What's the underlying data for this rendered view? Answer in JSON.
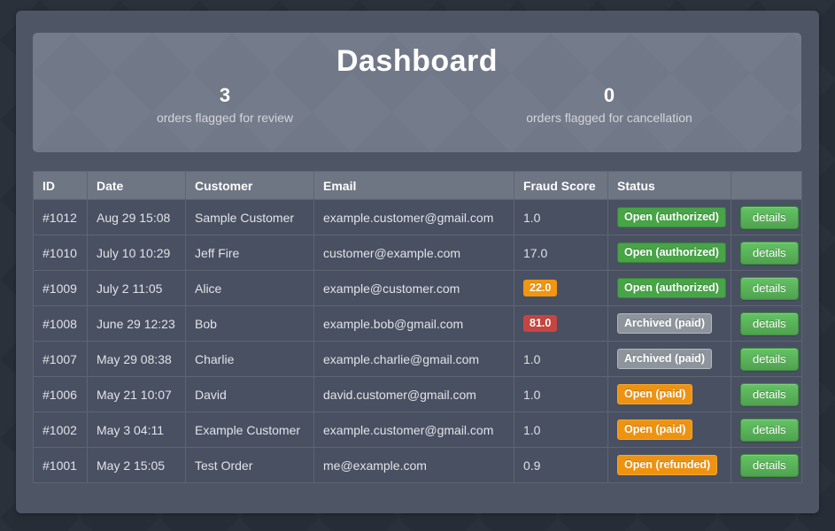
{
  "header": {
    "title": "Dashboard",
    "stats": [
      {
        "count": "3",
        "label": "orders flagged for review"
      },
      {
        "count": "0",
        "label": "orders flagged for cancellation"
      }
    ]
  },
  "table": {
    "columns": [
      "ID",
      "Date",
      "Customer",
      "Email",
      "Fraud Score",
      "Status",
      ""
    ],
    "details_label": "details",
    "rows": [
      {
        "id": "#1012",
        "date": "Aug 29 15:08",
        "customer": "Sample Customer",
        "email": "example.customer@gmail.com",
        "fraud_score": "1.0",
        "fraud_level": "plain",
        "status": "Open (authorized)",
        "status_type": "green"
      },
      {
        "id": "#1010",
        "date": "July 10 10:29",
        "customer": "Jeff Fire",
        "email": "customer@example.com",
        "fraud_score": "17.0",
        "fraud_level": "plain",
        "status": "Open (authorized)",
        "status_type": "green"
      },
      {
        "id": "#1009",
        "date": "July 2 11:05",
        "customer": "Alice",
        "email": "example@customer.com",
        "fraud_score": "22.0",
        "fraud_level": "orange",
        "status": "Open (authorized)",
        "status_type": "green"
      },
      {
        "id": "#1008",
        "date": "June 29 12:23",
        "customer": "Bob",
        "email": "example.bob@gmail.com",
        "fraud_score": "81.0",
        "fraud_level": "red",
        "status": "Archived (paid)",
        "status_type": "gray"
      },
      {
        "id": "#1007",
        "date": "May 29 08:38",
        "customer": "Charlie",
        "email": "example.charlie@gmail.com",
        "fraud_score": "1.0",
        "fraud_level": "plain",
        "status": "Archived (paid)",
        "status_type": "gray"
      },
      {
        "id": "#1006",
        "date": "May 21 10:07",
        "customer": "David",
        "email": "david.customer@gmail.com",
        "fraud_score": "1.0",
        "fraud_level": "plain",
        "status": "Open (paid)",
        "status_type": "orange"
      },
      {
        "id": "#1002",
        "date": "May 3 04:11",
        "customer": "Example Customer",
        "email": "example.customer@gmail.com",
        "fraud_score": "1.0",
        "fraud_level": "plain",
        "status": "Open (paid)",
        "status_type": "orange"
      },
      {
        "id": "#1001",
        "date": "May 2 15:05",
        "customer": "Test Order",
        "email": "me@example.com",
        "fraud_score": "0.9",
        "fraud_level": "plain",
        "status": "Open (refunded)",
        "status_type": "orange"
      }
    ]
  },
  "colors": {
    "page_background": "#272d37",
    "card_background": "#4e5564",
    "panel_background": "#717887",
    "table_header_background": "#6e7583",
    "row_background": "#495061",
    "status_green": "#47a447",
    "status_gray": "#8e949c",
    "status_orange": "#ee9311",
    "fraud_orange": "#f2960f",
    "fraud_red": "#c64540",
    "details_button_green": "#51a351"
  }
}
